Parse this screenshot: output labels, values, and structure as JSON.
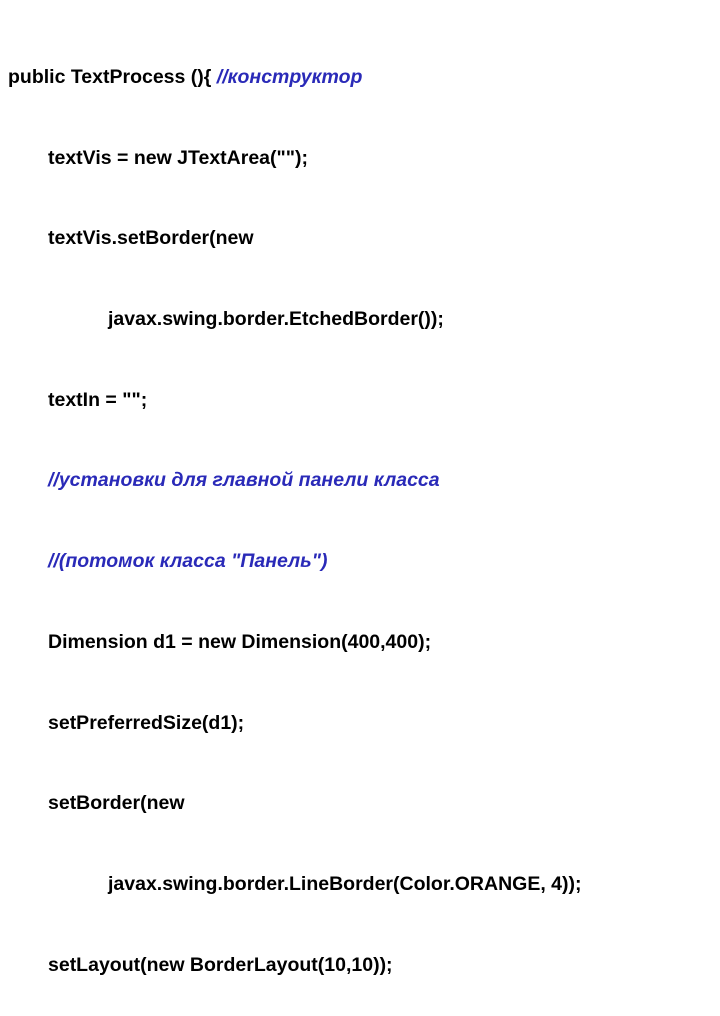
{
  "code": {
    "l1a": "public TextProcess (){ ",
    "l1b": "//конструктор",
    "l2": "textVis = new JTextArea(\"\");",
    "l3": "textVis.setBorder(new",
    "l4": "javax.swing.border.EtchedBorder());",
    "l5": "textIn = \"\";",
    "l6": "//установки для главной панели класса",
    "l7": "//(потомок класса \"Панель\")",
    "l8": "Dimension d1 = new Dimension(400,400);",
    "l9": "setPreferredSize(d1);",
    "l10": "setBorder(new",
    "l11": "javax.swing.border.LineBorder(Color.ORANGE, 4));",
    "l12": "setLayout(new BorderLayout(10,10));"
  }
}
